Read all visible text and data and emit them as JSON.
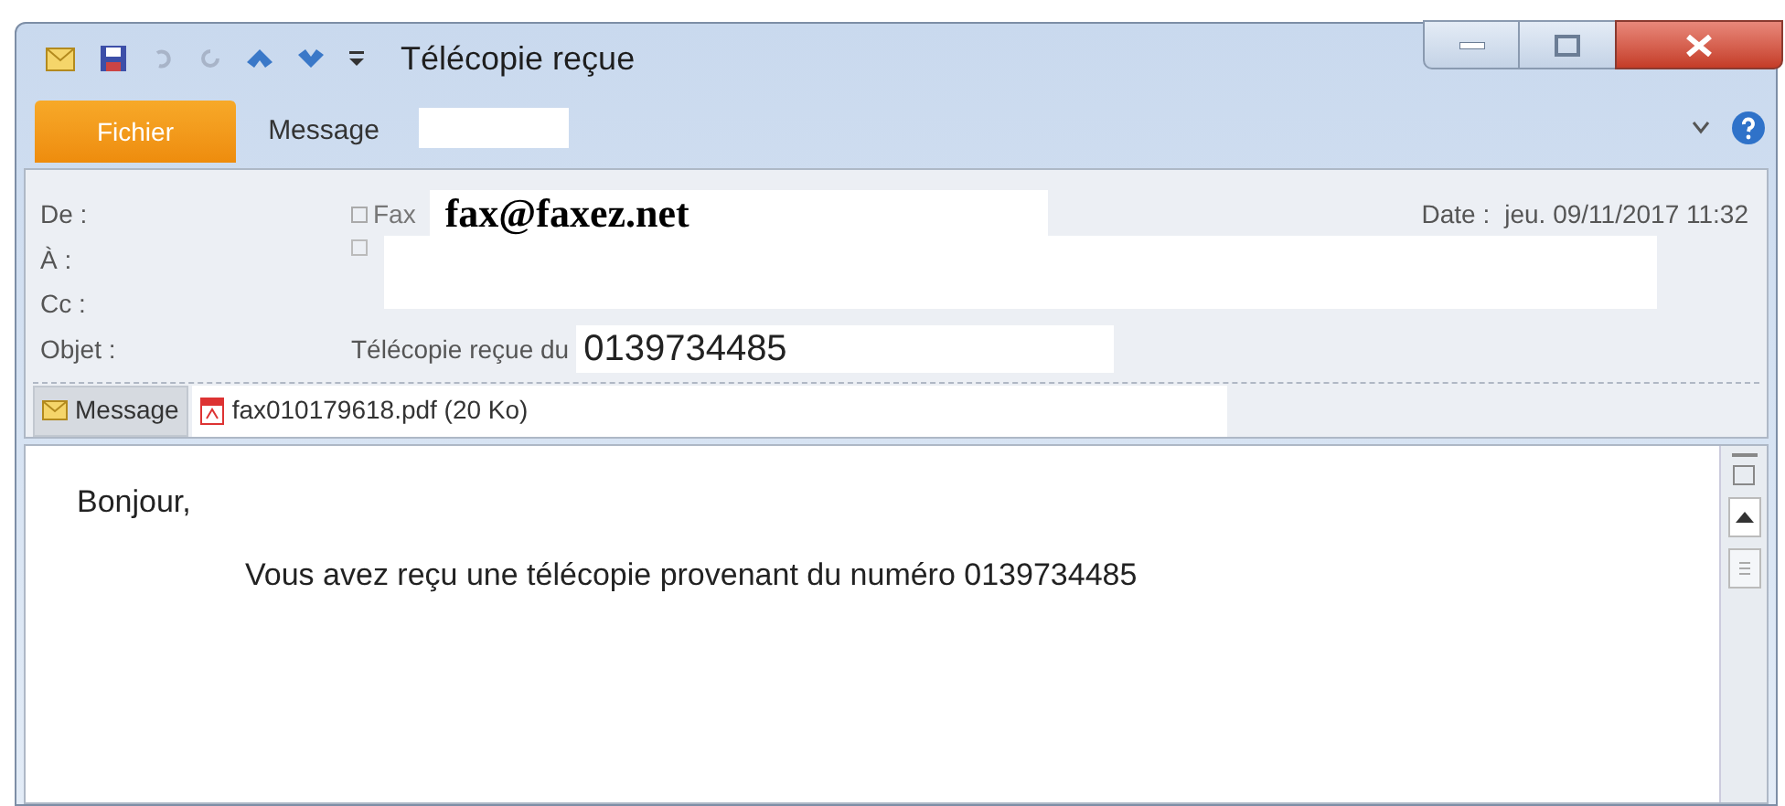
{
  "window": {
    "title": "Télécopie reçue"
  },
  "ribbon_tabs": [
    {
      "label": "Fichier",
      "kind": "file"
    },
    {
      "label": "Message",
      "kind": "tab"
    }
  ],
  "header": {
    "from": {
      "label": "De :",
      "sender_name": "Fax",
      "address": "fax@faxez.net"
    },
    "date": {
      "label": "Date :",
      "value": "jeu. 09/11/2017 11:32"
    },
    "to": {
      "label": "À :"
    },
    "cc": {
      "label": "Cc :"
    },
    "subject": {
      "label": "Objet :",
      "text": "Télécopie reçue du",
      "number": "0139734485"
    }
  },
  "attachments": [
    {
      "label": "Message",
      "kind": "message",
      "selected": true
    },
    {
      "label": "fax010179618.pdf (20 Ko)",
      "kind": "pdf",
      "selected": false
    }
  ],
  "body": {
    "paragraphs": [
      "Bonjour,",
      "Vous avez reçu une télécopie provenant du numéro 0139734485"
    ]
  }
}
